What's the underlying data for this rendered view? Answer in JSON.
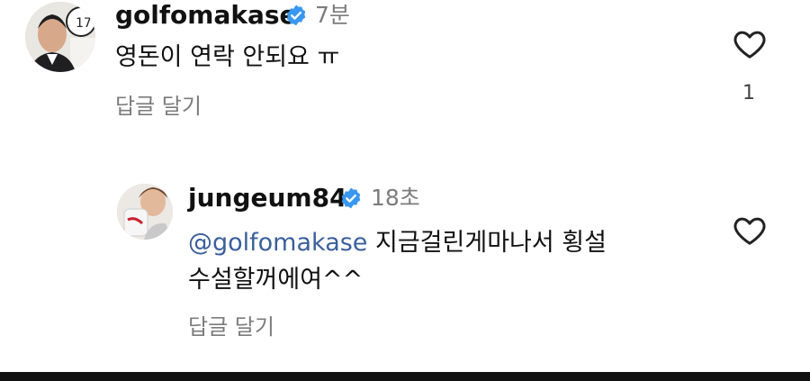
{
  "comments": [
    {
      "username": "golfomakase",
      "time": "7분",
      "text": "영돈이 연락 안되요 ㅠ",
      "reply_label": "답글 달기",
      "like_count": "1"
    }
  ],
  "replies": [
    {
      "username": "jungeum84",
      "time": "18초",
      "mention": "@golfomakase",
      "text_line1": " 지금걸린게마나서 횡설",
      "text_line2": "수설할꺼에여^^",
      "reply_label": "답글 달기"
    }
  ],
  "colors": {
    "verified_badge": "#3897f0",
    "mention": "#3a5f9c",
    "secondary_text": "#7c7c7c"
  }
}
